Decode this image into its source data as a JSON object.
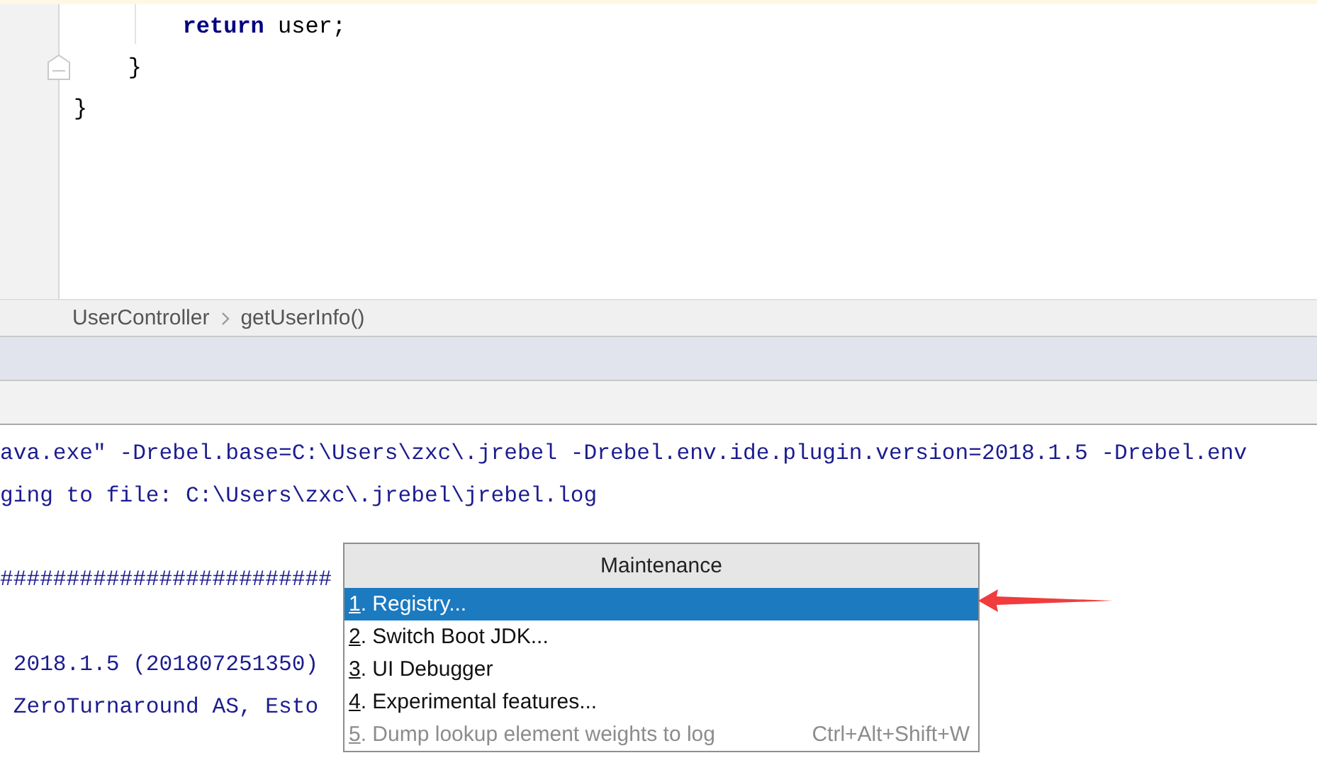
{
  "editor": {
    "code_lines": [
      {
        "children": [
          {
            "children": [
              {
                "tokens": [
                  {
                    "kind": "keyword",
                    "text": "return"
                  },
                  {
                    "kind": "plain",
                    "text": " user;"
                  }
                ]
              }
            ]
          },
          {
            "tokens": [
              {
                "kind": "plain",
                "text": "}"
              }
            ]
          }
        ]
      },
      {
        "tokens": [
          {
            "kind": "plain",
            "text": "}"
          }
        ]
      }
    ]
  },
  "breadcrumbs": [
    "UserController",
    "getUserInfo()"
  ],
  "console": {
    "lines": [
      {
        "kind": "text",
        "text": "ava.exe″ -Drebel.base=C:\\Users\\zxc\\.jrebel -Drebel.env.ide.plugin.version=2018.1.5 -Drebel.env"
      },
      {
        "kind": "text",
        "text": "ging to file: C:\\Users\\zxc\\.jrebel\\jrebel.log"
      },
      {
        "kind": "blank"
      },
      {
        "kind": "text",
        "text": "#########################"
      },
      {
        "kind": "blank"
      },
      {
        "kind": "text",
        "text": " 2018.1.5 (201807251350)"
      },
      {
        "kind": "text",
        "text": " ZeroTurnaround AS, Esto"
      }
    ]
  },
  "popup": {
    "title": "Maintenance",
    "items": [
      {
        "mnemonic": "1",
        "label": ". Registry...",
        "selected": true,
        "disabled": false
      },
      {
        "mnemonic": "2",
        "label": ". Switch Boot JDK...",
        "selected": false,
        "disabled": false
      },
      {
        "mnemonic": "3",
        "label": ". UI Debugger",
        "selected": false,
        "disabled": false
      },
      {
        "mnemonic": "4",
        "label": ". Experimental features...",
        "selected": false,
        "disabled": false
      },
      {
        "mnemonic": "5",
        "label": ". Dump lookup element weights to log",
        "shortcut": "Ctrl+Alt+Shift+W",
        "selected": false,
        "disabled": true
      }
    ]
  }
}
